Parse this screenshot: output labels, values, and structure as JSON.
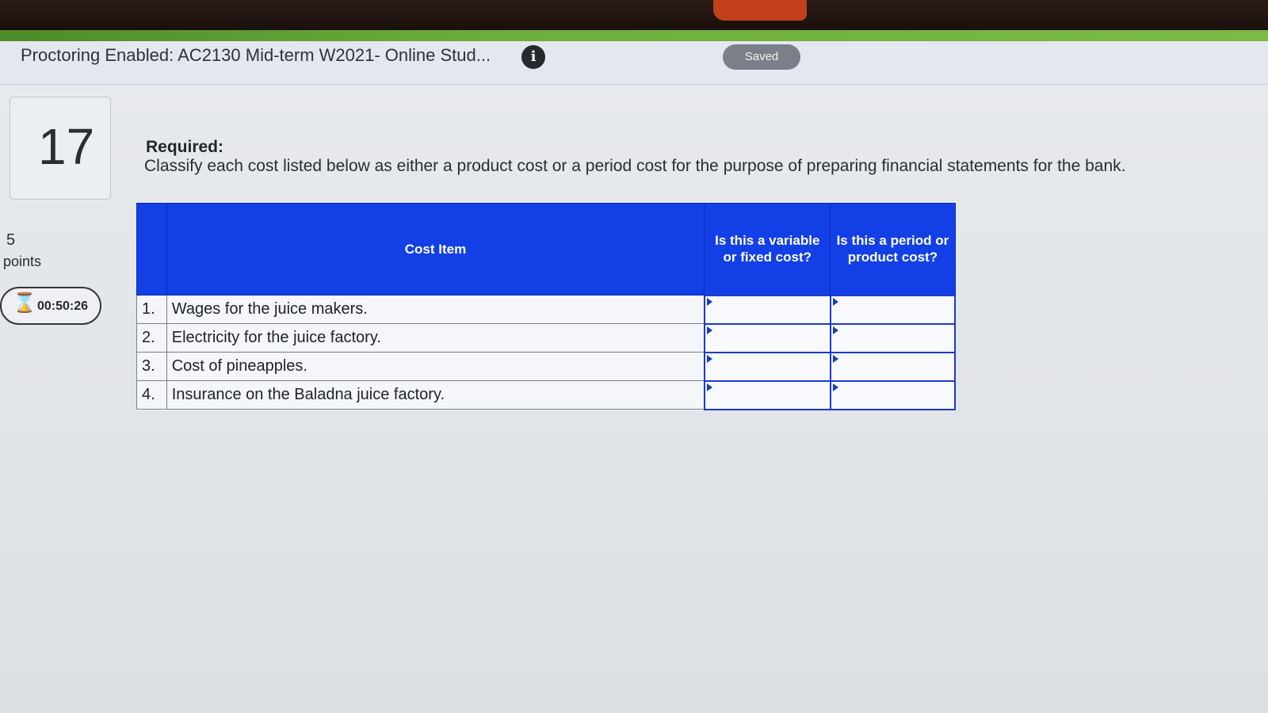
{
  "header": {
    "title": "Proctoring Enabled: AC2130 Mid-term W2021- Online Stud...",
    "info_icon": "info-icon",
    "saved_label": "Saved"
  },
  "question": {
    "number": "17",
    "points_value": "5",
    "points_label": "points",
    "timer": "00:50:26",
    "timer_icon": "hourglass-icon",
    "required_label": "Required:",
    "instruction": "Classify each cost listed below as either a product cost or a period cost for the purpose of preparing financial statements for the bank."
  },
  "table": {
    "headers": {
      "cost_item": "Cost Item",
      "variable_fixed": "Is this a variable or fixed cost?",
      "period_product": "Is this a period or product cost?"
    },
    "rows": [
      {
        "num": "1.",
        "item": "Wages for the juice makers.",
        "variable_fixed": "",
        "period_product": ""
      },
      {
        "num": "2.",
        "item": "Electricity for the juice factory.",
        "variable_fixed": "",
        "period_product": ""
      },
      {
        "num": "3.",
        "item": "Cost of pineapples.",
        "variable_fixed": "",
        "period_product": ""
      },
      {
        "num": "4.",
        "item": "Insurance on the Baladna juice factory.",
        "variable_fixed": "",
        "period_product": ""
      }
    ]
  },
  "colors": {
    "table_header_bg": "#1340e6",
    "accent_bar": "#6fae3c",
    "saved_pill": "#7a7f89"
  }
}
